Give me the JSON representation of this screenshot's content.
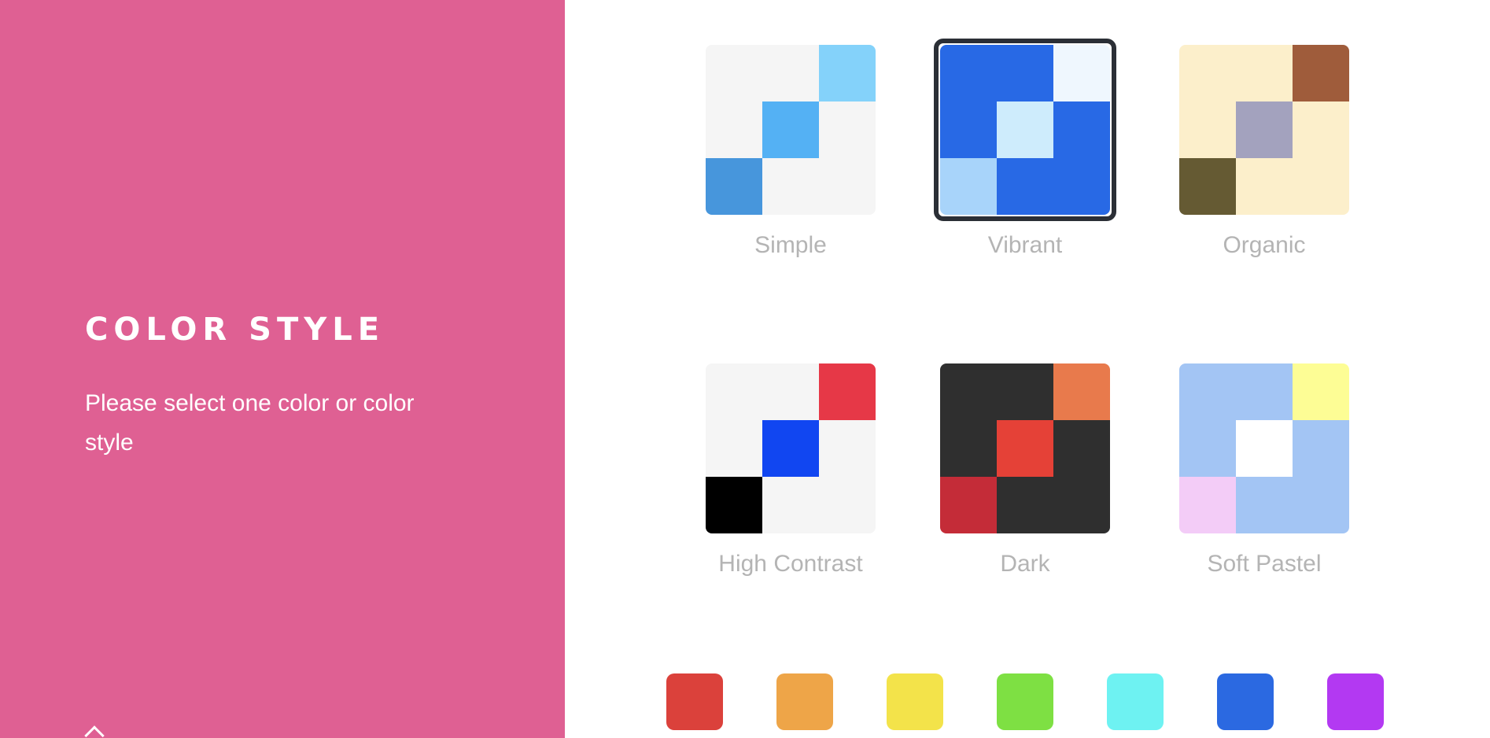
{
  "panel": {
    "title": "COLOR STYLE",
    "description": "Please select one color or color style",
    "background": "#df6093"
  },
  "styles": [
    {
      "label": "Simple",
      "selected": false,
      "cells": [
        "#f5f5f5",
        "#f5f5f5",
        "#84d2fa",
        "#f5f5f5",
        "#54b1f4",
        "#f5f5f5",
        "#4796dc",
        "#f5f5f5",
        "#f5f5f5"
      ]
    },
    {
      "label": "Vibrant",
      "selected": true,
      "cells": [
        "#2869e5",
        "#2869e5",
        "#eff7fe",
        "#2869e5",
        "#ceecfc",
        "#2869e5",
        "#a8d4fa",
        "#2869e5",
        "#2869e5"
      ]
    },
    {
      "label": "Organic",
      "selected": false,
      "cells": [
        "#fcefcb",
        "#fcefcb",
        "#9f5c3b",
        "#fcefcb",
        "#a3a2be",
        "#fcefcb",
        "#655a33",
        "#fcefcb",
        "#fcefcb"
      ]
    },
    {
      "label": "High Contrast",
      "selected": false,
      "cells": [
        "#f5f5f5",
        "#f5f5f5",
        "#e63847",
        "#f5f5f5",
        "#1146f1",
        "#f5f5f5",
        "#000000",
        "#f5f5f5",
        "#f5f5f5"
      ]
    },
    {
      "label": "Dark",
      "selected": false,
      "cells": [
        "#2f2f2f",
        "#2f2f2f",
        "#e87a4c",
        "#2f2f2f",
        "#e54137",
        "#2f2f2f",
        "#c42c38",
        "#2f2f2f",
        "#2f2f2f"
      ]
    },
    {
      "label": "Soft Pastel",
      "selected": false,
      "cells": [
        "#a3c5f4",
        "#a3c5f4",
        "#fdfd95",
        "#a3c5f4",
        "#ffffff",
        "#a3c5f4",
        "#f3ccf7",
        "#a3c5f4",
        "#a3c5f4"
      ]
    }
  ],
  "colors": [
    "#db413b",
    "#eea548",
    "#f3e34a",
    "#7ee043",
    "#6ef2f2",
    "#2b69e1",
    "#b339f2"
  ],
  "icons": {
    "back": "up-arrow-icon"
  }
}
